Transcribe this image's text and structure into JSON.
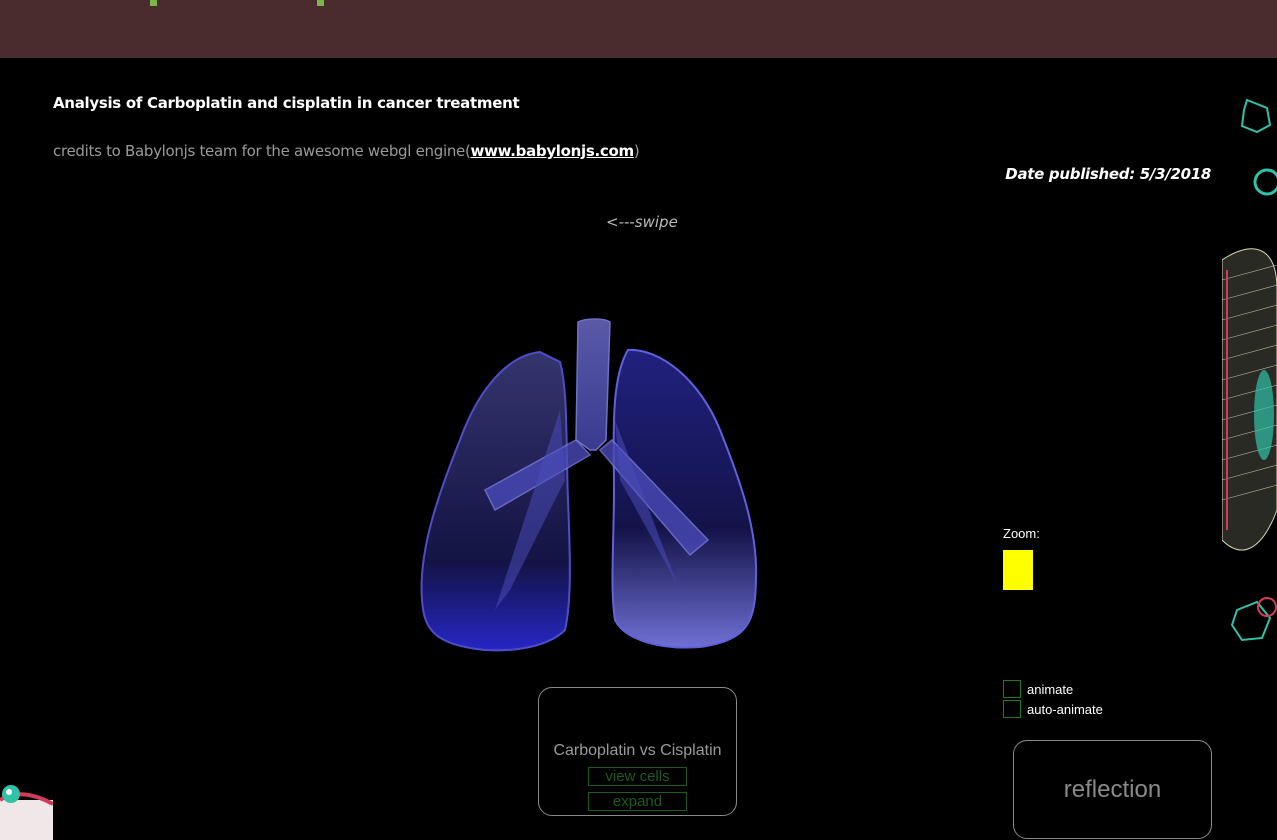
{
  "header": {
    "accent_color": "#4a2c2e",
    "tick_color": "#7ab648"
  },
  "article": {
    "title": "Analysis of Carboplatin and cisplatin in cancer treatment",
    "credits_prefix": "credits to Babylonjs team for the awesome webgl engine(",
    "credits_link": "www.babylonjs.com",
    "credits_suffix": ")",
    "date_published": "Date published: 5/3/2018",
    "swipe_hint": "<---swipe"
  },
  "viewer": {
    "model": "lungs-3d-model"
  },
  "controls": {
    "zoom_label": "Zoom:",
    "zoom_color": "#ffff00",
    "animate_label": "animate",
    "auto_animate_label": "auto-animate"
  },
  "panel": {
    "title": "Carboplatin vs Cisplatin",
    "view_cells_label": "view cells",
    "expand_label": "expand"
  },
  "reflection_label": "reflection"
}
